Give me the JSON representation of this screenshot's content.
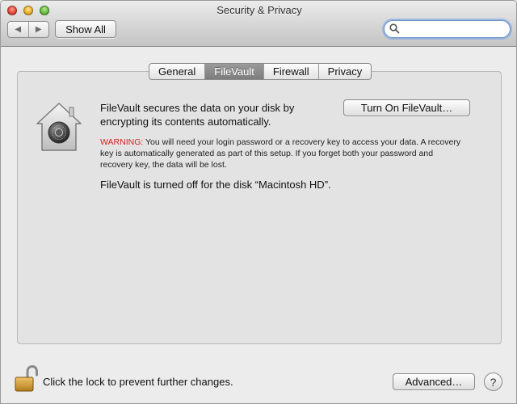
{
  "window": {
    "title": "Security & Privacy"
  },
  "toolbar": {
    "back_glyph": "◀",
    "forward_glyph": "▶",
    "show_all_label": "Show All",
    "search": {
      "value": "",
      "placeholder": ""
    }
  },
  "tabs": [
    {
      "label": "General",
      "active": false
    },
    {
      "label": "FileVault",
      "active": true
    },
    {
      "label": "Firewall",
      "active": false
    },
    {
      "label": "Privacy",
      "active": false
    }
  ],
  "filevault": {
    "icon": "filevault-house-icon",
    "description": "FileVault secures the data on your disk by encrypting its contents automatically.",
    "turn_on_label": "Turn On FileVault…",
    "warning_label": "WARNING:",
    "warning_text": " You will need your login password or a recovery key to access your data. A recovery key is automatically generated as part of this setup. If you forget both your password and recovery key, the data will be lost.",
    "status": "FileVault is turned off for the disk “Macintosh HD”."
  },
  "footer": {
    "lock_icon": "unlocked-padlock-icon",
    "lock_message": "Click the lock to prevent further changes.",
    "advanced_label": "Advanced…",
    "help_glyph": "?"
  },
  "colors": {
    "warning": "#d41f1f",
    "active_tab": "#8a8a8a",
    "focus_ring": "#6ea0e6"
  }
}
